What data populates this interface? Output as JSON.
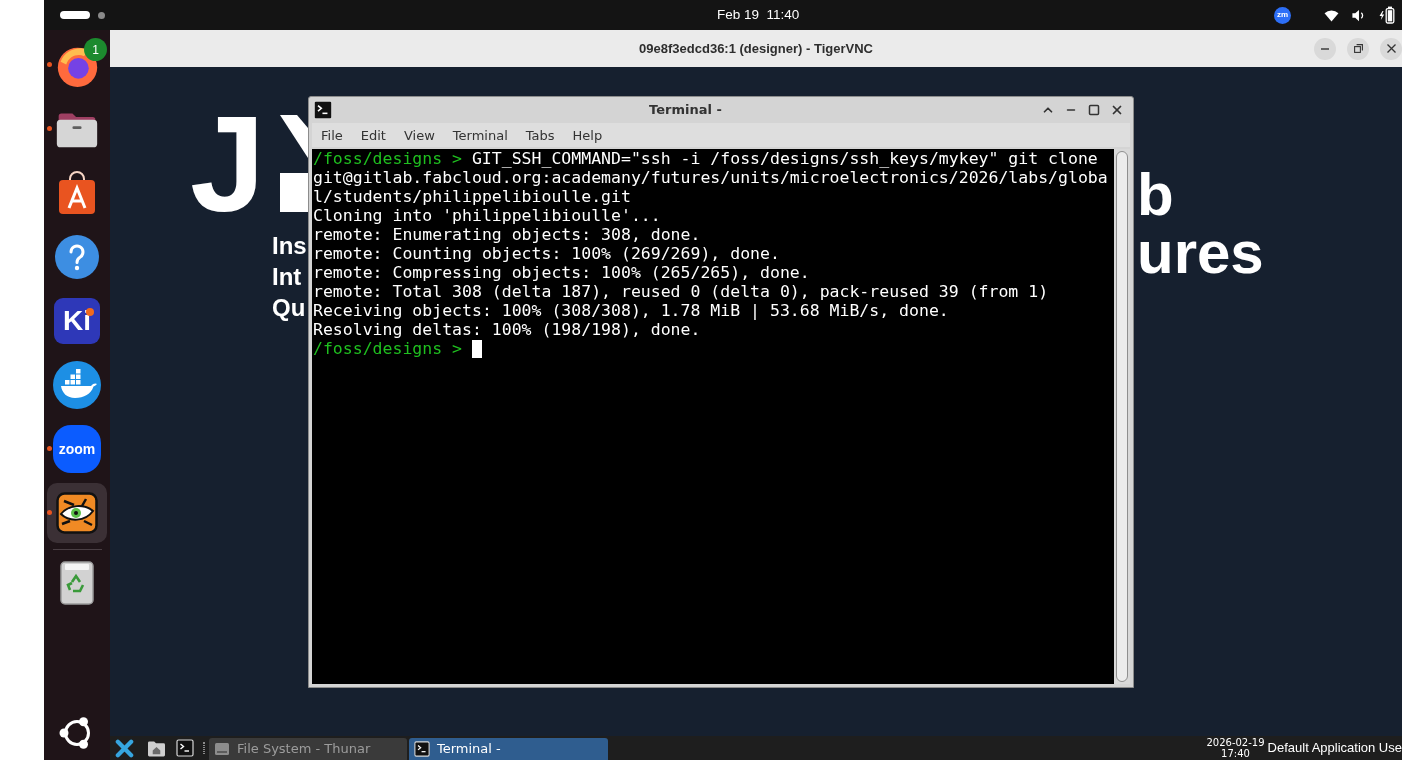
{
  "top_bar": {
    "workspaces": [
      {
        "selected": true
      },
      {
        "selected": false
      }
    ],
    "clock": "Feb 19  11:40",
    "indicator": "zm"
  },
  "dock": {
    "apps": [
      {
        "kind": "browser",
        "running": true,
        "selected": false,
        "urgent": false,
        "badge": "1"
      },
      {
        "kind": "files",
        "running": true,
        "selected": false,
        "urgent": false
      },
      {
        "kind": "store",
        "running": false,
        "selected": false,
        "urgent": false
      },
      {
        "kind": "help",
        "running": false,
        "selected": false,
        "urgent": false
      },
      {
        "kind": "tile",
        "text": "Ki",
        "running": false,
        "selected": false,
        "urgent": true
      },
      {
        "kind": "whale",
        "running": false,
        "selected": false,
        "urgent": false
      },
      {
        "kind": "bubble",
        "text": "zoom",
        "running": true,
        "selected": false,
        "urgent": false
      },
      {
        "kind": "tiger",
        "running": true,
        "selected": true,
        "urgent": false
      }
    ]
  },
  "vnc_window": {
    "title": "09e8f3edcd36:1 (designer) - TigerVNC",
    "wallpaper": {
      "letter": "J",
      "left_text": [
        "Ins",
        "Int",
        "Qu"
      ],
      "right_text": [
        "b",
        "ures"
      ]
    },
    "terminal": {
      "title": "Terminal -",
      "menu": [
        "File",
        "Edit",
        "View",
        "Terminal",
        "Tabs",
        "Help"
      ],
      "lines": [
        {
          "prompt": "/foss/designs >",
          "text": "GIT_SSH_COMMAND=\"ssh -i /foss/designs/ssh_keys/mykey\" git clone"
        },
        {
          "text": "git@gitlab.fabcloud.org:academany/futures/units/microelectronics/2026/labs/globa"
        },
        {
          "text": "l/students/philippelibioulle.git"
        },
        {
          "text": "Cloning into 'philippelibioulle'..."
        },
        {
          "text": "remote: Enumerating objects: 308, done."
        },
        {
          "text": "remote: Counting objects: 100% (269/269), done."
        },
        {
          "text": "remote: Compressing objects: 100% (265/265), done."
        },
        {
          "text": "remote: Total 308 (delta 187), reused 0 (delta 0), pack-reused 39 (from 1)"
        },
        {
          "text": "Receiving objects: 100% (308/308), 1.78 MiB | 53.68 MiB/s, done."
        },
        {
          "text": "Resolving deltas: 100% (198/198), done."
        },
        {
          "prompt": "/foss/designs >"
        }
      ],
      "cursor": true
    },
    "taskbar": {
      "windows": [
        {
          "kind": "files",
          "title": "File System - Thunar",
          "selected": false
        },
        {
          "kind": "terminal",
          "title": "Terminal -",
          "selected": true
        }
      ],
      "date": "2026-02-19",
      "time": "17:40",
      "status": "Default Application Use"
    }
  }
}
